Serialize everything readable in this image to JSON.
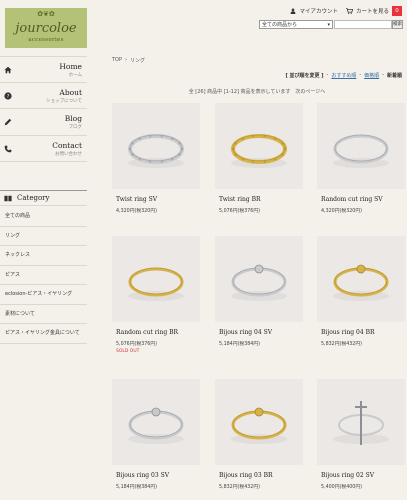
{
  "brand": {
    "logo_ornament": "✿❦✿",
    "logo_text": "jourcoloe",
    "logo_sub": "accessories",
    "accent": "#b3c276"
  },
  "header": {
    "account_label": "マイアカウント",
    "cart_label": "カートを見る",
    "cart_count": "0",
    "search": {
      "select_value": "全ての商品から",
      "button_label": "検索"
    }
  },
  "sidebar": {
    "nav": [
      {
        "title": "Home",
        "sub": "ホーム",
        "icon": "home-icon"
      },
      {
        "title": "About",
        "sub": "ショップについて",
        "icon": "info-icon"
      },
      {
        "title": "Blog",
        "sub": "ブログ",
        "icon": "pencil-icon"
      },
      {
        "title": "Contact",
        "sub": "お問い合わせ",
        "icon": "phone-icon"
      }
    ],
    "category_title": "Category",
    "categories": [
      "全ての商品",
      "リング",
      "ネックレス",
      "ピアス",
      "eclosion-ピアス・イヤリング",
      "素材について",
      "ピアス・イヤリング金具について"
    ]
  },
  "main": {
    "breadcrumb": [
      "TOP",
      "›",
      "リング"
    ],
    "sort": {
      "label": "[ 並び順を変更 ]",
      "sep1": "-",
      "recommended": "おすすめ順",
      "sep2": "-",
      "price": "価格順",
      "sep3": "-",
      "newest": "新着順"
    },
    "count_text": "全 [26] 商品中 [1-12] 商品を表示しています　次のページへ",
    "products": [
      {
        "name": "Twist ring SV",
        "price": "4,320円(税320円)",
        "sold_out": "",
        "metal": "silver",
        "style": "twist"
      },
      {
        "name": "Twist ring BR",
        "price": "5,076円(税376円)",
        "sold_out": "",
        "metal": "gold",
        "style": "twist"
      },
      {
        "name": "Random cut ring SV",
        "price": "4,320円(税320円)",
        "sold_out": "",
        "metal": "silver",
        "style": "plain"
      },
      {
        "name": "Random cut ring BR",
        "price": "5,076円(税376円)",
        "sold_out": "SOLD OUT",
        "metal": "gold",
        "style": "plain"
      },
      {
        "name": "Bijous ring 04 SV",
        "price": "5,184円(税384円)",
        "sold_out": "",
        "metal": "silver",
        "style": "bijou"
      },
      {
        "name": "Bijous ring 04 BR",
        "price": "5,832円(税432円)",
        "sold_out": "",
        "metal": "gold",
        "style": "bijou"
      },
      {
        "name": "Bijous ring 03 SV",
        "price": "5,184円(税384円)",
        "sold_out": "",
        "metal": "silver",
        "style": "bijou"
      },
      {
        "name": "Bijous ring 03 BR",
        "price": "5,832円(税432円)",
        "sold_out": "",
        "metal": "gold",
        "style": "bijou"
      },
      {
        "name": "Bijous ring 02 SV",
        "price": "5,400円(税400円)",
        "sold_out": "",
        "metal": "silver",
        "style": "cross"
      }
    ]
  }
}
